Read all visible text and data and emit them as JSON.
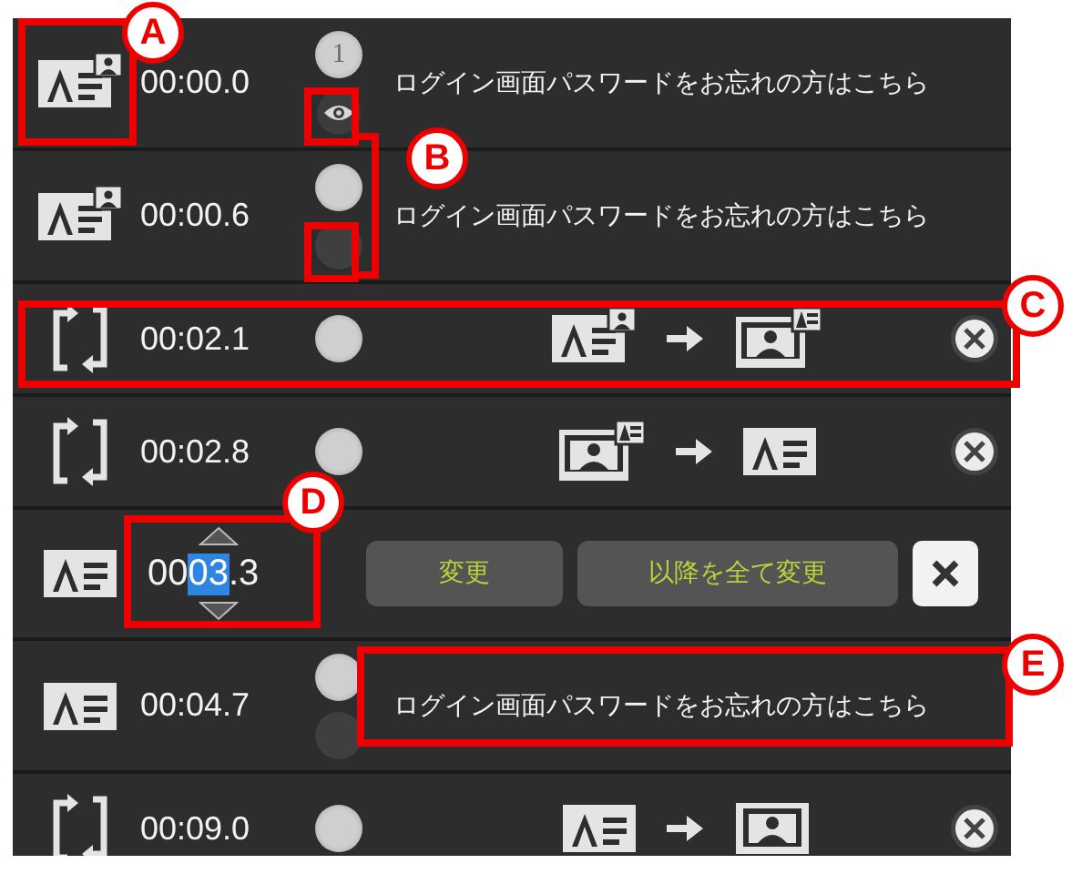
{
  "rows": [
    {
      "kind": "caption",
      "icon": {
        "kind": "text-image"
      },
      "time": "00:00.0",
      "markers": [
        {
          "kind": "numbered",
          "label": "1"
        },
        {
          "kind": "eye"
        }
      ],
      "text": "ログイン画面パスワードをお忘れの方はこちら"
    },
    {
      "kind": "caption",
      "icon": {
        "kind": "text-image"
      },
      "time": "00:00.6",
      "markers": [
        {
          "kind": "light"
        },
        {
          "kind": "dark"
        }
      ],
      "text": "ログイン画面パスワードをお忘れの方はこちら"
    },
    {
      "kind": "transition",
      "time": "00:02.1",
      "from": {
        "kind": "text-image"
      },
      "to": {
        "kind": "screen-text"
      }
    },
    {
      "kind": "transition",
      "time": "00:02.8",
      "from": {
        "kind": "screen-text"
      },
      "to": {
        "kind": "text"
      }
    },
    {
      "kind": "edit",
      "icon": {
        "kind": "text"
      },
      "time_parts": [
        {
          "text": "00",
          "selected": false
        },
        {
          "text": "03",
          "selected": true
        },
        {
          "text": ".3",
          "selected": false
        }
      ],
      "buttons": [
        "変更",
        "以降を全て変更"
      ]
    },
    {
      "kind": "caption",
      "icon": {
        "kind": "text"
      },
      "time": "00:04.7",
      "markers": [
        {
          "kind": "light"
        },
        {
          "kind": "dark"
        }
      ],
      "text": "ログイン画面パスワードをお忘れの方はこちら"
    },
    {
      "kind": "transition",
      "time": "00:09.0",
      "from": {
        "kind": "text"
      },
      "to": {
        "kind": "screen"
      }
    }
  ],
  "callouts": [
    {
      "label": "A"
    },
    {
      "label": "B"
    },
    {
      "label": "C"
    },
    {
      "label": "D"
    },
    {
      "label": "E"
    }
  ]
}
